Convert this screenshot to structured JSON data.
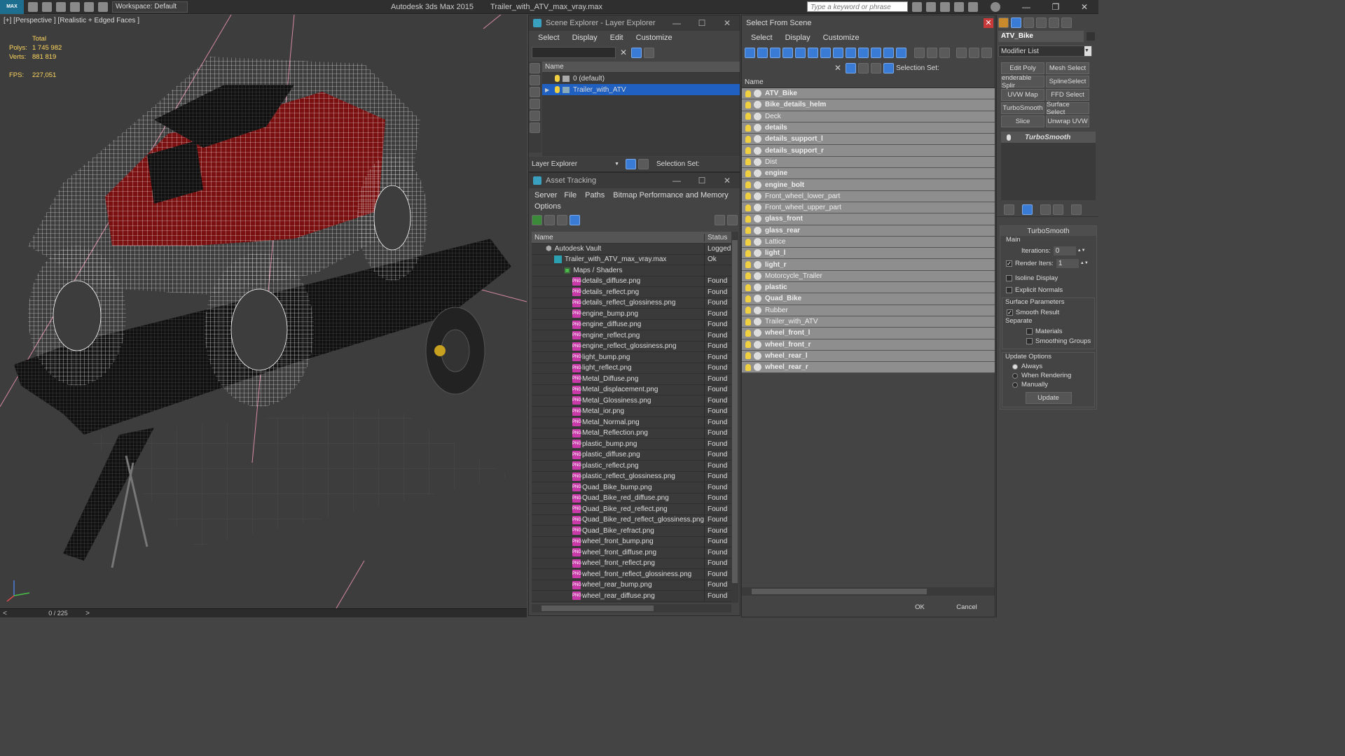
{
  "titlebar": {
    "app_title": "Autodesk 3ds Max  2015",
    "file": "Trailer_with_ATV_max_vray.max",
    "workspace": "Workspace: Default",
    "search_placeholder": "Type a keyword or phrase",
    "logo_text": "MAX"
  },
  "viewport": {
    "label": "[+] [Perspective ] [Realistic + Edged Faces ]",
    "stats_total": "Total",
    "polys_label": "Polys:",
    "polys_value": "1 745 982",
    "verts_label": "Verts:",
    "verts_value": "881 819",
    "fps_label": "FPS:",
    "fps_value": "227,051"
  },
  "timeline": {
    "frame": "0 / 225",
    "prev": "<",
    "next": ">"
  },
  "scene_explorer": {
    "title": "Scene Explorer - Layer Explorer",
    "menu": [
      "Select",
      "Display",
      "Edit",
      "Customize"
    ],
    "col_name": "Name",
    "layers": [
      "0 (default)",
      "Trailer_with_ATV"
    ],
    "footer_dropdown": "Layer Explorer",
    "selection_set": "Selection Set:"
  },
  "asset_tracking": {
    "title": "Asset Tracking",
    "menu": [
      "Server",
      "File",
      "Paths",
      "Bitmap Performance and Memory"
    ],
    "menu2": "Options",
    "col_name": "Name",
    "col_status": "Status",
    "vault": {
      "name": "Autodesk Vault",
      "status": "Logged"
    },
    "file": {
      "name": "Trailer_with_ATV_max_vray.max",
      "status": "Ok"
    },
    "folder": "Maps / Shaders",
    "maps": [
      {
        "name": "details_diffuse.png",
        "status": "Found"
      },
      {
        "name": "details_reflect.png",
        "status": "Found"
      },
      {
        "name": "details_reflect_glossiness.png",
        "status": "Found"
      },
      {
        "name": "engine_bump.png",
        "status": "Found"
      },
      {
        "name": "engine_diffuse.png",
        "status": "Found"
      },
      {
        "name": "engine_reflect.png",
        "status": "Found"
      },
      {
        "name": "engine_reflect_glossiness.png",
        "status": "Found"
      },
      {
        "name": "light_bump.png",
        "status": "Found"
      },
      {
        "name": "light_reflect.png",
        "status": "Found"
      },
      {
        "name": "Metal_Diffuse.png",
        "status": "Found"
      },
      {
        "name": "Metal_displacement.png",
        "status": "Found"
      },
      {
        "name": "Metal_Glossiness.png",
        "status": "Found"
      },
      {
        "name": "Metal_ior.png",
        "status": "Found"
      },
      {
        "name": "Metal_Normal.png",
        "status": "Found"
      },
      {
        "name": "Metal_Reflection.png",
        "status": "Found"
      },
      {
        "name": "plastic_bump.png",
        "status": "Found"
      },
      {
        "name": "plastic_diffuse.png",
        "status": "Found"
      },
      {
        "name": "plastic_reflect.png",
        "status": "Found"
      },
      {
        "name": "plastic_reflect_glossiness.png",
        "status": "Found"
      },
      {
        "name": "Quad_Bike_bump.png",
        "status": "Found"
      },
      {
        "name": "Quad_Bike_red_diffuse.png",
        "status": "Found"
      },
      {
        "name": "Quad_Bike_red_reflect.png",
        "status": "Found"
      },
      {
        "name": "Quad_Bike_red_reflect_glossiness.png",
        "status": "Found"
      },
      {
        "name": "Quad_Bike_refract.png",
        "status": "Found"
      },
      {
        "name": "wheel_front_bump.png",
        "status": "Found"
      },
      {
        "name": "wheel_front_diffuse.png",
        "status": "Found"
      },
      {
        "name": "wheel_front_reflect.png",
        "status": "Found"
      },
      {
        "name": "wheel_front_reflect_glossiness.png",
        "status": "Found"
      },
      {
        "name": "wheel_rear_bump.png",
        "status": "Found"
      },
      {
        "name": "wheel_rear_diffuse.png",
        "status": "Found"
      }
    ]
  },
  "select_from_scene": {
    "title": "Select From Scene",
    "menu": [
      "Select",
      "Display",
      "Customize"
    ],
    "selection_set": "Selection Set:",
    "col_name": "Name",
    "objects": [
      {
        "name": "ATV_Bike",
        "bold": true
      },
      {
        "name": "Bike_details_helm",
        "bold": true
      },
      {
        "name": "Deck",
        "bold": false
      },
      {
        "name": "details",
        "bold": true
      },
      {
        "name": "details_support_l",
        "bold": true
      },
      {
        "name": "details_support_r",
        "bold": true
      },
      {
        "name": "Dist",
        "bold": false
      },
      {
        "name": "engine",
        "bold": true
      },
      {
        "name": "engine_bolt",
        "bold": true
      },
      {
        "name": "Front_wheel_lower_part",
        "bold": false
      },
      {
        "name": "Front_wheel_upper_part",
        "bold": false
      },
      {
        "name": "glass_front",
        "bold": true
      },
      {
        "name": "glass_rear",
        "bold": true
      },
      {
        "name": "Lattice",
        "bold": false
      },
      {
        "name": "light_l",
        "bold": true
      },
      {
        "name": "light_r",
        "bold": true
      },
      {
        "name": "Motorcycle_Trailer",
        "bold": false
      },
      {
        "name": "plastic",
        "bold": true
      },
      {
        "name": "Quad_Bike",
        "bold": true
      },
      {
        "name": "Rubber",
        "bold": false
      },
      {
        "name": "Trailer_with_ATV",
        "bold": false
      },
      {
        "name": "wheel_front_l",
        "bold": true
      },
      {
        "name": "wheel_front_r",
        "bold": true
      },
      {
        "name": "wheel_rear_l",
        "bold": true
      },
      {
        "name": "wheel_rear_r",
        "bold": true
      }
    ],
    "ok": "OK",
    "cancel": "Cancel"
  },
  "command_panel": {
    "object_name": "ATV_Bike",
    "modifier_list": "Modifier List",
    "modifier_buttons": [
      "Edit Poly",
      "Mesh Select",
      "enderable Splir",
      "SplineSelect",
      "UVW Map",
      "FFD Select",
      "TurboSmooth",
      "Surface Select",
      "Slice",
      "Unwrap UVW"
    ],
    "stack_item": "TurboSmooth",
    "rollout_title": "TurboSmooth",
    "main_label": "Main",
    "iterations_label": "Iterations:",
    "iterations_value": "0",
    "render_iters_label": "Render Iters:",
    "render_iters_value": "1",
    "isoline": "Isoline Display",
    "explicit_normals": "Explicit Normals",
    "surface_params": "Surface Parameters",
    "smooth_result": "Smooth Result",
    "separate": "Separate",
    "materials": "Materials",
    "smoothing_groups": "Smoothing Groups",
    "update_options": "Update Options",
    "always": "Always",
    "when_rendering": "When Rendering",
    "manually": "Manually",
    "update": "Update"
  }
}
